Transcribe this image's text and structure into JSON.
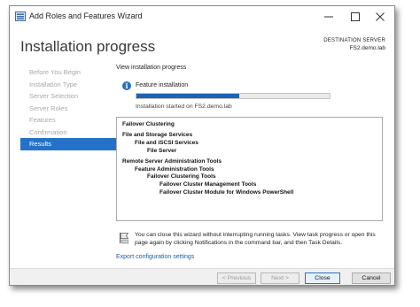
{
  "window": {
    "title": "Add Roles and Features Wizard",
    "controls": {
      "minimize": "–",
      "maximize": "□",
      "close": "✕"
    }
  },
  "header": {
    "heading": "Installation progress",
    "destination_label": "DESTINATION SERVER",
    "destination_value": "FS2.demo.lab"
  },
  "nav": {
    "items": [
      {
        "label": "Before You Begin",
        "active": false
      },
      {
        "label": "Installation Type",
        "active": false
      },
      {
        "label": "Server Selection",
        "active": false
      },
      {
        "label": "Server Roles",
        "active": false
      },
      {
        "label": "Features",
        "active": false
      },
      {
        "label": "Confirmation",
        "active": false
      },
      {
        "label": "Results",
        "active": true
      }
    ]
  },
  "main": {
    "view_text": "View installation progress",
    "feature_installation": "Feature installation",
    "progress_fraction": 0.53,
    "installation_started": "Installation started on FS2.demo.lab",
    "results": [
      {
        "text": "Failover Clustering",
        "bold": true,
        "indent": 0
      },
      {
        "text": "File and Storage Services",
        "bold": true,
        "indent": 0
      },
      {
        "text": "File and iSCSI Services",
        "bold": true,
        "indent": 1
      },
      {
        "text": "File Server",
        "bold": true,
        "indent": 2
      },
      {
        "text": "Remote Server Administration Tools",
        "bold": true,
        "indent": 0
      },
      {
        "text": "Feature Administration Tools",
        "bold": true,
        "indent": 1
      },
      {
        "text": "Failover Clustering Tools",
        "bold": true,
        "indent": 2
      },
      {
        "text": "Failover Cluster Management Tools",
        "bold": true,
        "indent": 3
      },
      {
        "text": "Failover Cluster Module for Windows PowerShell",
        "bold": true,
        "indent": 3
      }
    ],
    "note_text": "You can close this wizard without interrupting running tasks. View task progress or open this page again by clicking Notifications in the command bar, and then Task Details.",
    "export_link": "Export configuration settings"
  },
  "footer": {
    "previous": "< Previous",
    "next": "Next >",
    "close": "Close",
    "cancel": "Cancel"
  },
  "colors": {
    "accent": "#2472c8",
    "progress": "#1e63b5",
    "link": "#1a5fa8"
  }
}
